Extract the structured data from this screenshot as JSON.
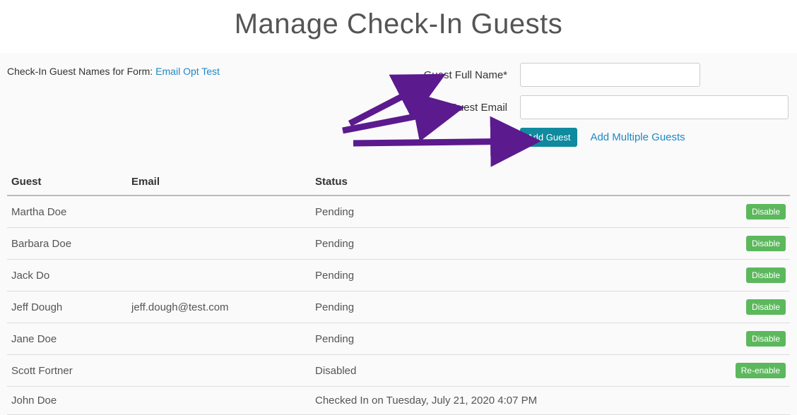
{
  "page": {
    "title": "Manage Check-In Guests",
    "form_intro_label": "Check-In Guest Names for Form:",
    "form_link": "Email Opt Test"
  },
  "form": {
    "name_label": "Guest Full Name*",
    "name_value": "",
    "email_label": "Guest Email",
    "email_value": "",
    "add_button": "Add Guest",
    "add_multiple_link": "Add Multiple Guests"
  },
  "table": {
    "headers": {
      "guest": "Guest",
      "email": "Email",
      "status": "Status"
    },
    "rows": [
      {
        "guest": "Martha Doe",
        "email": "",
        "status": "Pending",
        "action": "Disable"
      },
      {
        "guest": "Barbara Doe",
        "email": "",
        "status": "Pending",
        "action": "Disable"
      },
      {
        "guest": "Jack Do",
        "email": "",
        "status": "Pending",
        "action": "Disable"
      },
      {
        "guest": "Jeff Dough",
        "email": "jeff.dough@test.com",
        "status": "Pending",
        "action": "Disable"
      },
      {
        "guest": "Jane Doe",
        "email": "",
        "status": "Pending",
        "action": "Disable"
      },
      {
        "guest": "Scott Fortner",
        "email": "",
        "status": "Disabled",
        "action": "Re-enable"
      },
      {
        "guest": "John Doe",
        "email": "",
        "status": "Checked In on Tuesday, July 21, 2020 4:07 PM",
        "action": ""
      }
    ]
  }
}
